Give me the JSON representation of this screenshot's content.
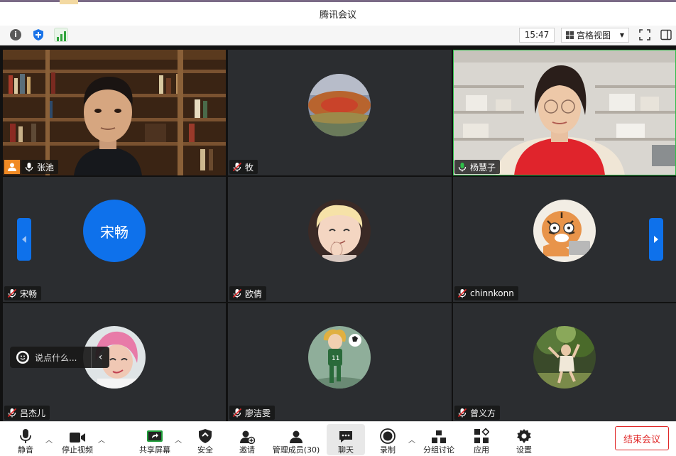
{
  "window": {
    "title": "腾讯会议"
  },
  "toolbar": {
    "time": "15:47",
    "view_label": "宫格视图"
  },
  "participants": [
    {
      "name": "张池",
      "mic": "on",
      "video": true,
      "host": true
    },
    {
      "name": "牧",
      "mic": "muted",
      "video": false
    },
    {
      "name": "杨慧子",
      "mic": "on-active",
      "video": true,
      "active": true
    },
    {
      "name": "宋畅",
      "mic": "muted",
      "video": false,
      "avatar_text": "宋畅"
    },
    {
      "name": "欧倩",
      "mic": "muted",
      "video": false
    },
    {
      "name": "chinnkonn",
      "mic": "muted",
      "video": false
    },
    {
      "name": "吕杰儿",
      "mic": "muted",
      "video": false
    },
    {
      "name": "廖洁雯",
      "mic": "muted",
      "video": false
    },
    {
      "name": "曾义方",
      "mic": "muted",
      "video": false
    }
  ],
  "chat_input": {
    "placeholder": "说点什么..."
  },
  "controls": {
    "mute": "静音",
    "stop_video": "停止视频",
    "share_screen": "共享屏幕",
    "security": "安全",
    "invite": "邀请",
    "manage_members": "管理成员(30)",
    "chat": "聊天",
    "record": "录制",
    "breakout": "分组讨论",
    "apps": "应用",
    "settings": "设置",
    "end_meeting": "结束会议"
  },
  "colors": {
    "accent": "#0e71eb",
    "end": "#e02828",
    "host_badge": "#f08a24",
    "active_speaker": "#2fbf4a"
  }
}
